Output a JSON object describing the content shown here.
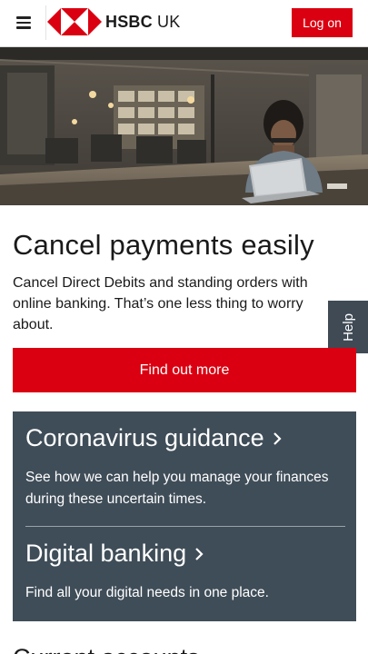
{
  "header": {
    "menu_icon": "hamburger-menu-icon",
    "brand_name": "HSBC",
    "brand_region": "UK",
    "login_label": "Log on",
    "brand_color": "#db0011"
  },
  "hero": {
    "image": "person-working-on-laptop-in-office"
  },
  "main": {
    "headline": "Cancel payments easily",
    "description": "Cancel Direct Debits and standing orders with online banking. That’s one less thing to worry about.",
    "cta_label": "Find out more"
  },
  "help_tab": {
    "label": "Help"
  },
  "promo": {
    "background": "#3f4d58",
    "items": [
      {
        "title": "Coronavirus guidance",
        "description": "See how we can help you manage your finances during these uncertain times."
      },
      {
        "title": "Digital banking",
        "description": "Find all your digital needs in one place."
      }
    ]
  },
  "bottom": {
    "heading": "Current accounts"
  }
}
